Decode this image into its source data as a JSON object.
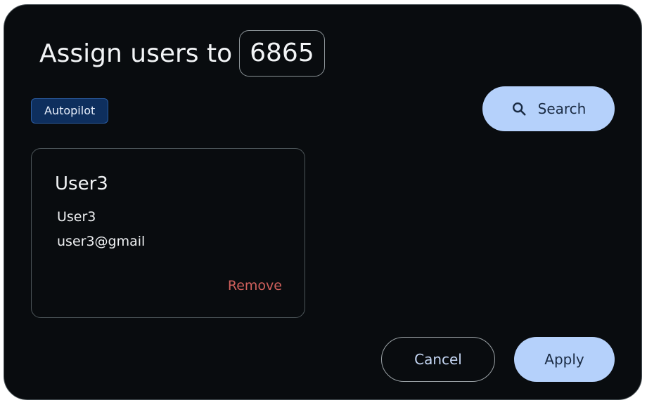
{
  "dialog": {
    "title": "Assign users to",
    "target_id": "6865"
  },
  "badge": {
    "label": "Autopilot"
  },
  "search": {
    "label": "Search",
    "icon": "search-icon"
  },
  "user_card": {
    "name": "User3",
    "username": "User3",
    "email": "user3@gmail",
    "remove_label": "Remove"
  },
  "actions": {
    "cancel_label": "Cancel",
    "apply_label": "Apply"
  },
  "colors": {
    "background": "#090c0f",
    "accent": "#b5d1fb",
    "badge": "#0e2f5e",
    "danger": "#d0605c"
  }
}
